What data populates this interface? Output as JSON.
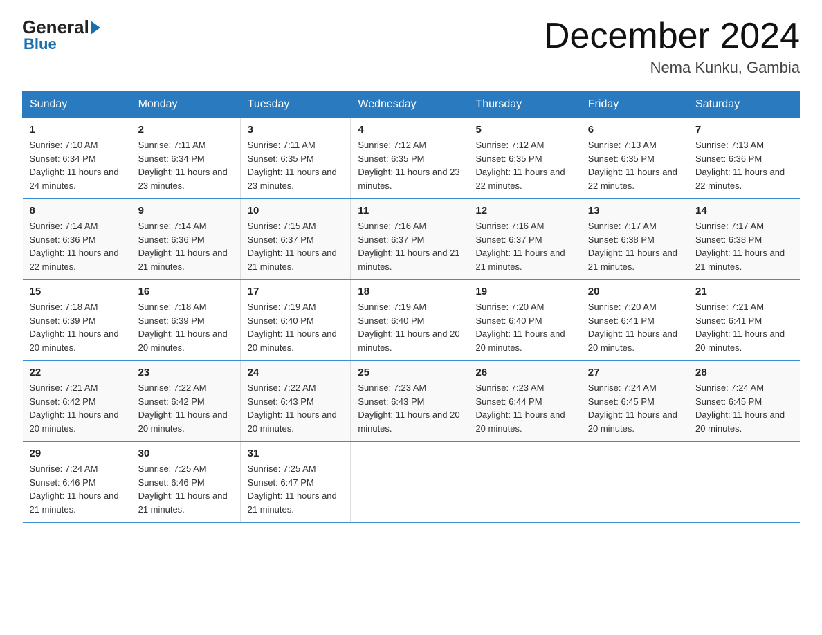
{
  "logo": {
    "general": "General",
    "blue": "Blue"
  },
  "title": "December 2024",
  "subtitle": "Nema Kunku, Gambia",
  "days_of_week": [
    "Sunday",
    "Monday",
    "Tuesday",
    "Wednesday",
    "Thursday",
    "Friday",
    "Saturday"
  ],
  "weeks": [
    [
      {
        "day": "1",
        "sunrise": "7:10 AM",
        "sunset": "6:34 PM",
        "daylight": "11 hours and 24 minutes."
      },
      {
        "day": "2",
        "sunrise": "7:11 AM",
        "sunset": "6:34 PM",
        "daylight": "11 hours and 23 minutes."
      },
      {
        "day": "3",
        "sunrise": "7:11 AM",
        "sunset": "6:35 PM",
        "daylight": "11 hours and 23 minutes."
      },
      {
        "day": "4",
        "sunrise": "7:12 AM",
        "sunset": "6:35 PM",
        "daylight": "11 hours and 23 minutes."
      },
      {
        "day": "5",
        "sunrise": "7:12 AM",
        "sunset": "6:35 PM",
        "daylight": "11 hours and 22 minutes."
      },
      {
        "day": "6",
        "sunrise": "7:13 AM",
        "sunset": "6:35 PM",
        "daylight": "11 hours and 22 minutes."
      },
      {
        "day": "7",
        "sunrise": "7:13 AM",
        "sunset": "6:36 PM",
        "daylight": "11 hours and 22 minutes."
      }
    ],
    [
      {
        "day": "8",
        "sunrise": "7:14 AM",
        "sunset": "6:36 PM",
        "daylight": "11 hours and 22 minutes."
      },
      {
        "day": "9",
        "sunrise": "7:14 AM",
        "sunset": "6:36 PM",
        "daylight": "11 hours and 21 minutes."
      },
      {
        "day": "10",
        "sunrise": "7:15 AM",
        "sunset": "6:37 PM",
        "daylight": "11 hours and 21 minutes."
      },
      {
        "day": "11",
        "sunrise": "7:16 AM",
        "sunset": "6:37 PM",
        "daylight": "11 hours and 21 minutes."
      },
      {
        "day": "12",
        "sunrise": "7:16 AM",
        "sunset": "6:37 PM",
        "daylight": "11 hours and 21 minutes."
      },
      {
        "day": "13",
        "sunrise": "7:17 AM",
        "sunset": "6:38 PM",
        "daylight": "11 hours and 21 minutes."
      },
      {
        "day": "14",
        "sunrise": "7:17 AM",
        "sunset": "6:38 PM",
        "daylight": "11 hours and 21 minutes."
      }
    ],
    [
      {
        "day": "15",
        "sunrise": "7:18 AM",
        "sunset": "6:39 PM",
        "daylight": "11 hours and 20 minutes."
      },
      {
        "day": "16",
        "sunrise": "7:18 AM",
        "sunset": "6:39 PM",
        "daylight": "11 hours and 20 minutes."
      },
      {
        "day": "17",
        "sunrise": "7:19 AM",
        "sunset": "6:40 PM",
        "daylight": "11 hours and 20 minutes."
      },
      {
        "day": "18",
        "sunrise": "7:19 AM",
        "sunset": "6:40 PM",
        "daylight": "11 hours and 20 minutes."
      },
      {
        "day": "19",
        "sunrise": "7:20 AM",
        "sunset": "6:40 PM",
        "daylight": "11 hours and 20 minutes."
      },
      {
        "day": "20",
        "sunrise": "7:20 AM",
        "sunset": "6:41 PM",
        "daylight": "11 hours and 20 minutes."
      },
      {
        "day": "21",
        "sunrise": "7:21 AM",
        "sunset": "6:41 PM",
        "daylight": "11 hours and 20 minutes."
      }
    ],
    [
      {
        "day": "22",
        "sunrise": "7:21 AM",
        "sunset": "6:42 PM",
        "daylight": "11 hours and 20 minutes."
      },
      {
        "day": "23",
        "sunrise": "7:22 AM",
        "sunset": "6:42 PM",
        "daylight": "11 hours and 20 minutes."
      },
      {
        "day": "24",
        "sunrise": "7:22 AM",
        "sunset": "6:43 PM",
        "daylight": "11 hours and 20 minutes."
      },
      {
        "day": "25",
        "sunrise": "7:23 AM",
        "sunset": "6:43 PM",
        "daylight": "11 hours and 20 minutes."
      },
      {
        "day": "26",
        "sunrise": "7:23 AM",
        "sunset": "6:44 PM",
        "daylight": "11 hours and 20 minutes."
      },
      {
        "day": "27",
        "sunrise": "7:24 AM",
        "sunset": "6:45 PM",
        "daylight": "11 hours and 20 minutes."
      },
      {
        "day": "28",
        "sunrise": "7:24 AM",
        "sunset": "6:45 PM",
        "daylight": "11 hours and 20 minutes."
      }
    ],
    [
      {
        "day": "29",
        "sunrise": "7:24 AM",
        "sunset": "6:46 PM",
        "daylight": "11 hours and 21 minutes."
      },
      {
        "day": "30",
        "sunrise": "7:25 AM",
        "sunset": "6:46 PM",
        "daylight": "11 hours and 21 minutes."
      },
      {
        "day": "31",
        "sunrise": "7:25 AM",
        "sunset": "6:47 PM",
        "daylight": "11 hours and 21 minutes."
      },
      null,
      null,
      null,
      null
    ]
  ]
}
